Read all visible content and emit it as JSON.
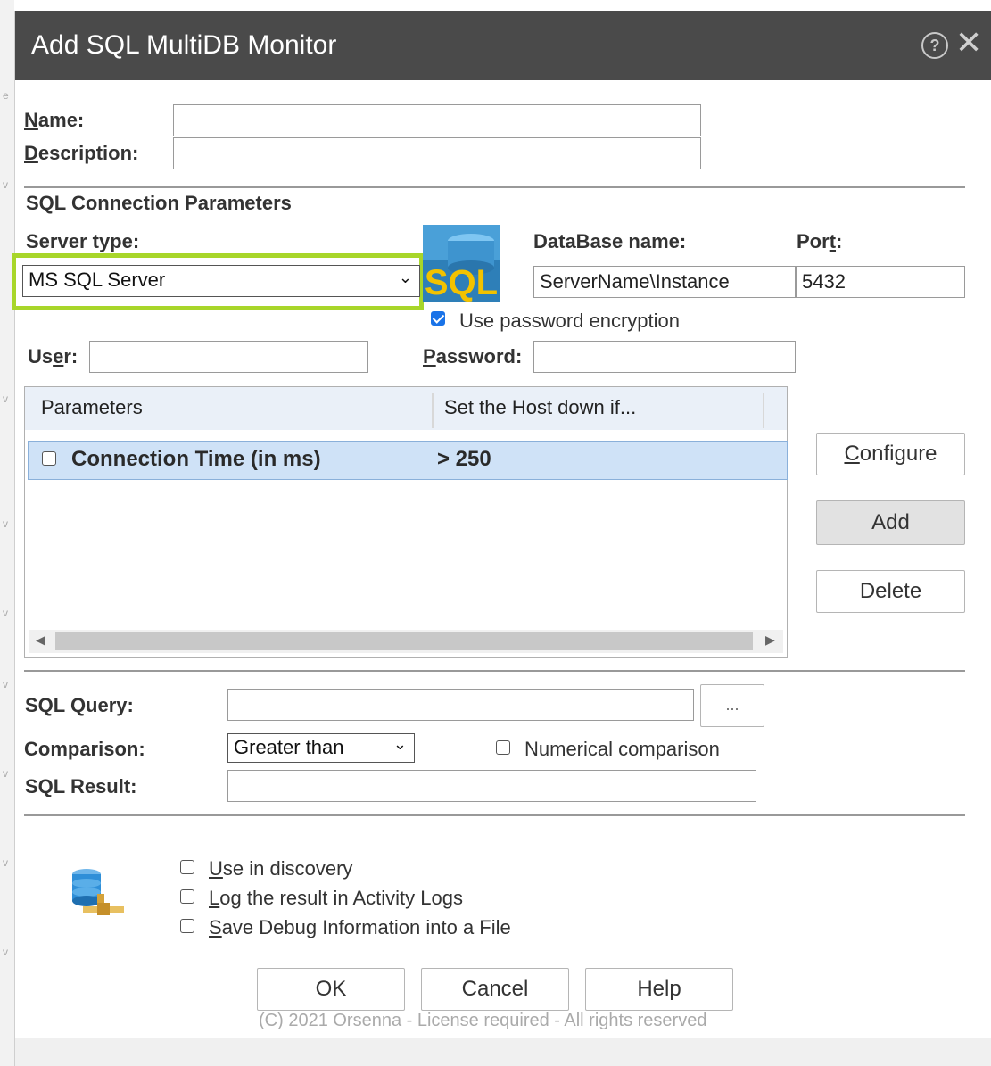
{
  "dialog": {
    "title": "Add SQL MultiDB Monitor",
    "help_icon": "help-circle-icon",
    "close_icon": "close-icon"
  },
  "general": {
    "name_label": "Name:",
    "name_value": "",
    "description_label": "Description:",
    "description_value": ""
  },
  "connection": {
    "section_title": "SQL Connection Parameters",
    "server_type_label": "Server type:",
    "server_type_value": "MS SQL Server",
    "db_icon": "sql-database-icon",
    "database_label": "DataBase name:",
    "database_value": "ServerName\\Instance",
    "port_label": "Port:",
    "port_value": "5432",
    "encryption_label": "Use password encryption",
    "encryption_checked": true,
    "user_label": "User:",
    "user_value": "",
    "password_label": "Password:",
    "password_value": ""
  },
  "parameters_grid": {
    "columns": [
      "Parameters",
      "Set the Host down if..."
    ],
    "rows": [
      {
        "parameter": "Connection Time (in ms)",
        "condition": "> 250",
        "checked": false
      }
    ]
  },
  "side_buttons": {
    "configure": "Configure",
    "add": "Add",
    "delete": "Delete"
  },
  "query": {
    "sql_query_label": "SQL Query:",
    "sql_query_value": "",
    "browse_label": "...",
    "comparison_label": "Comparison:",
    "comparison_value": "Greater than",
    "numerical_label": "Numerical comparison",
    "numerical_checked": false,
    "sql_result_label": "SQL Result:",
    "sql_result_value": ""
  },
  "options": {
    "icon": "database-network-icon",
    "use_in_discovery": "Use in discovery",
    "log_result": "Log the result in Activity Logs",
    "save_debug": "Save Debug Information into a File"
  },
  "footer": {
    "ok": "OK",
    "cancel": "Cancel",
    "help": "Help",
    "copyright": "(C) 2021 Orsenna - License required - All rights reserved"
  },
  "colors": {
    "titlebar": "#4a4a4a",
    "highlight": "#a8d62a",
    "selected_row": "#cfe2f7",
    "checkbox_accent": "#1a73e8"
  }
}
